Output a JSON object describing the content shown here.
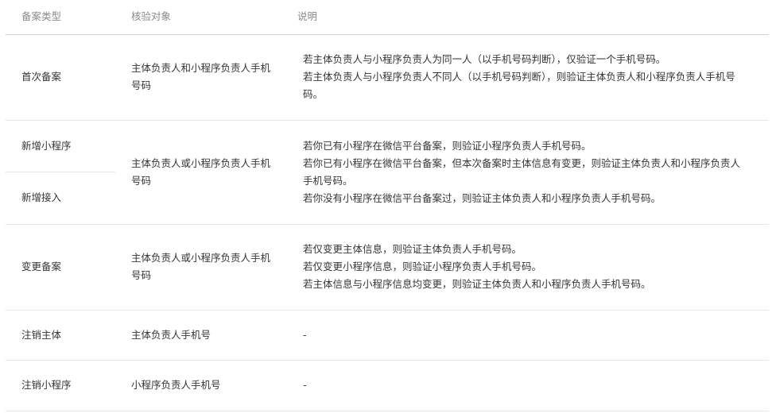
{
  "header": {
    "col_type": "备案类型",
    "col_target": "核验对象",
    "col_desc": "说明"
  },
  "rows": [
    {
      "type": "首次备案",
      "target": "主体负责人和小程序负责人手机号码",
      "desc": [
        "若主体负责人与小程序负责人为同一人（以手机号码判断），仅验证一个手机号码。",
        "若主体负责人与小程序负责人不同人（以手机号码判断），则验证主体负责人和小程序负责人手机号码。"
      ]
    },
    {
      "types": [
        "新增小程序",
        "新增接入"
      ],
      "target": "主体负责人或小程序负责人手机号码",
      "desc": [
        "若你已有小程序在微信平台备案，则验证小程序负责人手机号码。",
        "若你已有小程序在微信平台备案，但本次备案时主体信息有变更，则验证主体负责人和小程序负责人手机号码。",
        "若你没有小程序在微信平台备案过，则验证主体负责人和小程序负责人手机号码。"
      ]
    },
    {
      "type": "变更备案",
      "target": "主体负责人或小程序负责人手机号码",
      "desc": [
        "若仅变更主体信息，则验证主体负责人手机号码。",
        "若仅变更小程序信息，则验证小程序负责人手机号码。",
        "若主体信息与小程序信息均变更，则验证主体负责人和小程序负责人手机号码。"
      ]
    },
    {
      "type": "注销主体",
      "target": "主体负责人手机号",
      "desc": [
        "-"
      ]
    },
    {
      "type": "注销小程序",
      "target": "小程序负责人手机号",
      "desc": [
        "-"
      ]
    }
  ]
}
